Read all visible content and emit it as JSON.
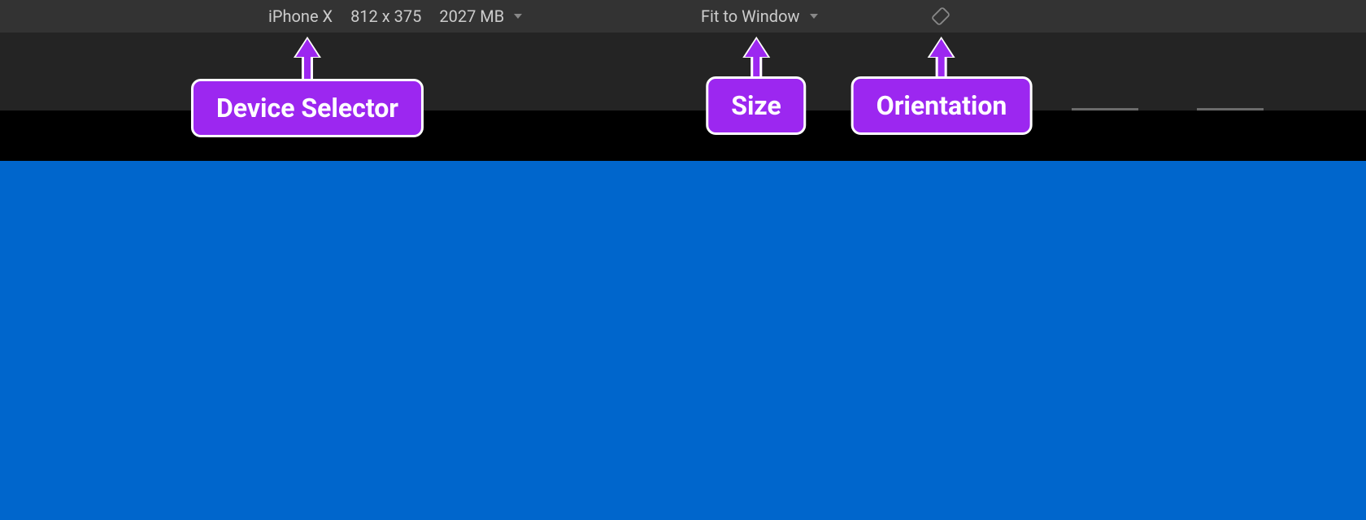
{
  "toolbar": {
    "device": "iPhone X",
    "dimensions": "812 x 375",
    "memory": "2027 MB",
    "zoom": "Fit to Window"
  },
  "annotations": {
    "device_selector": "Device Selector",
    "size": "Size",
    "orientation": "Orientation"
  },
  "colors": {
    "callout": "#9c27f0",
    "content_bg": "#0066cc",
    "toolbar_bg": "#333333",
    "band_bg": "#242424"
  }
}
